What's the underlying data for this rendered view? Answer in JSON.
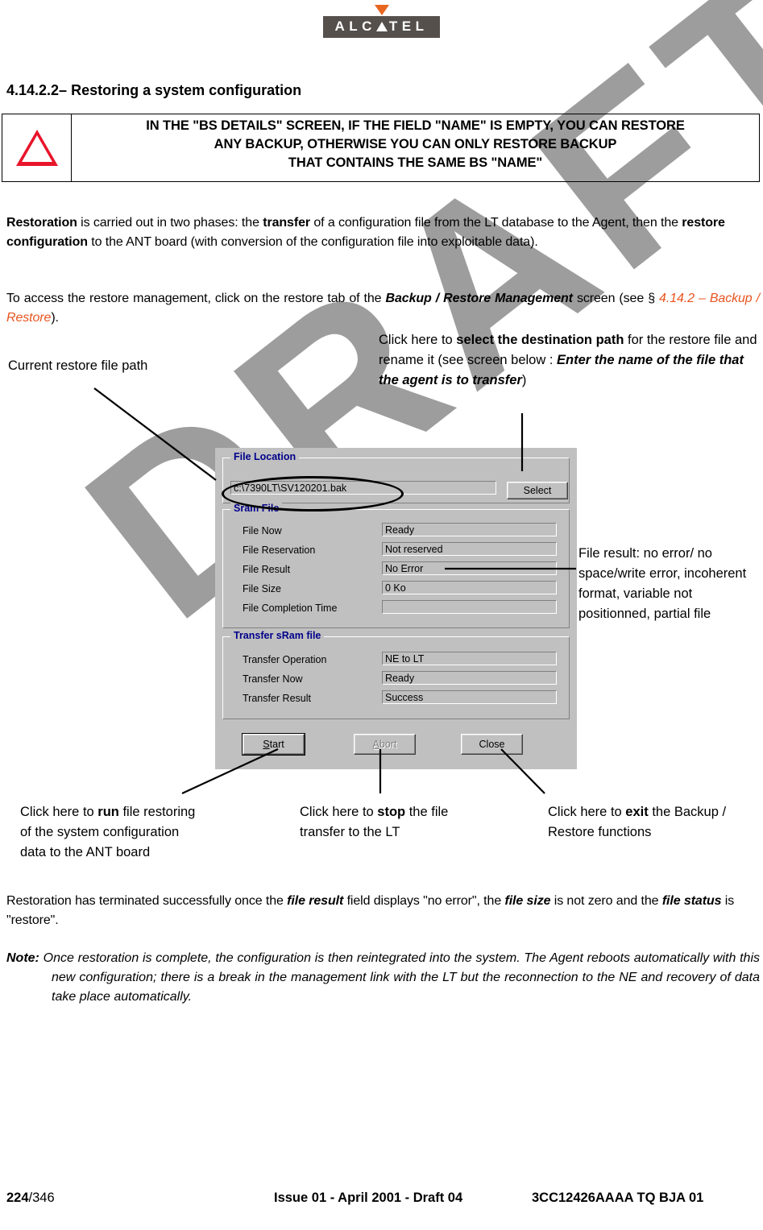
{
  "logo": {
    "brand_left": "ALC",
    "brand_right": "TEL",
    "triangle_color": "#E8661E",
    "box_color": "#55504C"
  },
  "heading": "4.14.2.2–  Restoring a system configuration",
  "warning": {
    "line1": "IN THE \"BS DETAILS\" SCREEN, IF THE FIELD \"NAME\" IS EMPTY, YOU CAN RESTORE",
    "line2": "ANY BACKUP, OTHERWISE YOU CAN ONLY RESTORE BACKUP",
    "line3": "THAT CONTAINS THE SAME BS \"NAME\"",
    "icon_color": "#E8152B"
  },
  "paragraphs": {
    "p1_a": "Restoration",
    "p1_b": " is carried out in two phases: the ",
    "p1_c": "transfer",
    "p1_d": " of a configuration file from the LT database to the Agent, then the ",
    "p1_e": "restore configuration",
    "p1_f": " to the ANT board (with conversion of the configuration file into exploitable data).",
    "p2_a": "To access the restore management, click on the restore tab of the ",
    "p2_b": "Backup / Restore Management",
    "p2_c": " screen (see § ",
    "p2_xref": "4.14.2 – Backup / Restore",
    "p2_d": ").",
    "p3_a": "Restoration has terminated successfully once the ",
    "p3_b": "file result",
    "p3_c": " field displays \"no error\", the ",
    "p3_d": "file size",
    "p3_e": " is not zero and the ",
    "p3_f": "file status",
    "p3_g": " is \"restore\".",
    "note_label": "Note:",
    "note_text": " Once restoration is complete, the configuration is then reintegrated into the system. The Agent reboots automatically with this new configuration; there is a break in the management link with the LT but the reconnection to the NE and recovery of data take place automatically."
  },
  "annotations": {
    "current_path": "Current restore file path",
    "select_a": "Click here to ",
    "select_b": "select the destination path",
    "select_c": " for the restore file and rename it (see screen below : ",
    "select_d": "Enter the name of the file that the agent is to transfer",
    "select_e": ")",
    "file_result": "File result: no error/ no space/write error, incoherent format, variable not positionned, partial file",
    "run_a": "Click here to ",
    "run_b": "run",
    "run_c": " file restoring of the system configuration data to the ANT board",
    "stop_a": "Click here to ",
    "stop_b": "stop",
    "stop_c": " the file transfer to the LT",
    "exit_a": "Click here to ",
    "exit_b": "exit",
    "exit_c": " the Backup / Restore functions"
  },
  "dialog": {
    "file_location": {
      "title": "File Location",
      "path_value": "c:\\7390LT\\SV120201.bak",
      "select_button": "Select",
      "select_button_accel": "S"
    },
    "sram_file": {
      "title": "Sram File",
      "rows": [
        {
          "label": "File Now",
          "value": "Ready"
        },
        {
          "label": "File Reservation",
          "value": "Not reserved"
        },
        {
          "label": "File Result",
          "value": "No Error"
        },
        {
          "label": "File Size",
          "value": "0 Ko"
        },
        {
          "label": "File Completion Time",
          "value": ""
        }
      ]
    },
    "transfer": {
      "title": "Transfer sRam file",
      "rows": [
        {
          "label": "Transfer Operation",
          "value": "NE to LT"
        },
        {
          "label": "Transfer Now",
          "value": "Ready"
        },
        {
          "label": "Transfer Result",
          "value": "Success"
        }
      ]
    },
    "buttons": {
      "start_accel": "S",
      "start_rest": "tart",
      "abort_accel": "A",
      "abort_rest": "bort",
      "close": "Close"
    },
    "colors": {
      "face": "#c0c0c0",
      "group_title": "#00008B"
    }
  },
  "watermark": {
    "text": "DRAFT",
    "color": "#9d9d9d"
  },
  "footer": {
    "page_current": "224",
    "page_total": "/346",
    "issue": "Issue 01 - April 2001 - Draft 04",
    "reference": "3CC12426AAAA TQ BJA 01"
  }
}
